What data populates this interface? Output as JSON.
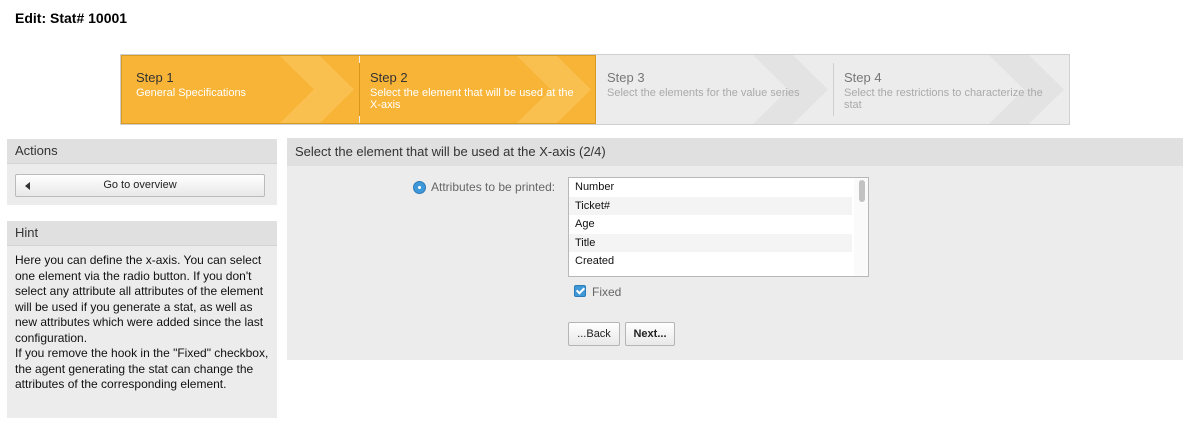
{
  "page": {
    "title": "Edit: Stat# 10001"
  },
  "steps": [
    {
      "number": "Step 1",
      "description": "General Specifications",
      "state": "completed"
    },
    {
      "number": "Step 2",
      "description": "Select the element that will be used at the X-axis",
      "state": "current"
    },
    {
      "number": "Step 3",
      "description": "Select the elements for the value series",
      "state": "pending"
    },
    {
      "number": "Step 4",
      "description": "Select the restrictions to characterize the stat",
      "state": "pending"
    }
  ],
  "sidebar": {
    "actions": {
      "title": "Actions",
      "overview_button": "Go to overview"
    },
    "hint": {
      "title": "Hint",
      "paragraph1": "Here you can define the x-axis. You can select one element via the radio button. If you don't select any attribute all attributes of the element will be used if you generate a stat, as well as new attributes which were added since the last configuration.",
      "paragraph2": "If you remove the hook in the \"Fixed\" checkbox, the agent generating the stat can change the attributes of the corresponding element."
    }
  },
  "main": {
    "heading": "Select the element that will be used at the X-axis (2/4)",
    "attribute_label": "Attributes to be printed:",
    "attribute_selected": true,
    "attributes": [
      "Number",
      "Ticket#",
      "Age",
      "Title",
      "Created"
    ],
    "fixed_label": "Fixed",
    "fixed_checked": true,
    "back_button": "...Back",
    "next_button": "Next..."
  },
  "colors": {
    "accent_orange": "#f8b437",
    "accent_blue": "#3f98d8",
    "panel_bg": "#ececec"
  }
}
